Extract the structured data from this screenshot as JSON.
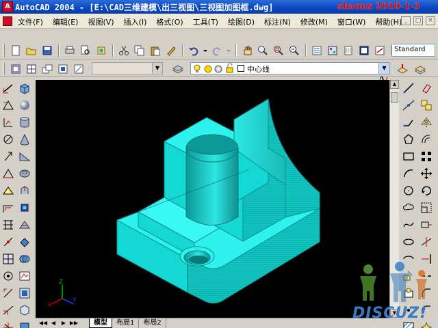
{
  "window": {
    "title": "AutoCAD 2004 - [E:\\CAD三维建模\\出三视图\\三视图加图框.dwg]",
    "watermark": "shaonx 2010-1-3",
    "app_icon_label": "A"
  },
  "menu": {
    "items": [
      "文件(F)",
      "编辑(E)",
      "视图(V)",
      "插入(I)",
      "格式(O)",
      "工具(T)",
      "绘图(D)",
      "标注(N)",
      "修改(M)",
      "窗口(W)",
      "帮助(H)"
    ],
    "doc_buttons": [
      "_",
      "□",
      "×"
    ]
  },
  "toolbar": {
    "text_style": "Standard",
    "layer_name": "中心线"
  },
  "tabs": {
    "nav": [
      "◀◀",
      "◀",
      "▶",
      "▶▶"
    ],
    "items": [
      "模型",
      "布局1",
      "布局2"
    ],
    "active_index": 0
  },
  "ucs": {
    "x": "X",
    "y": "Y",
    "z": "Z"
  },
  "watermark_logo": "DISCUZ!",
  "colors": {
    "model_face_top": "#2ef2ee",
    "model_face_left": "#14d8d4",
    "model_face_right": "#0fb6b4",
    "viewport_bg": "#000000",
    "title_bar": "#0a46c0",
    "watermark_red": "#e80000"
  }
}
